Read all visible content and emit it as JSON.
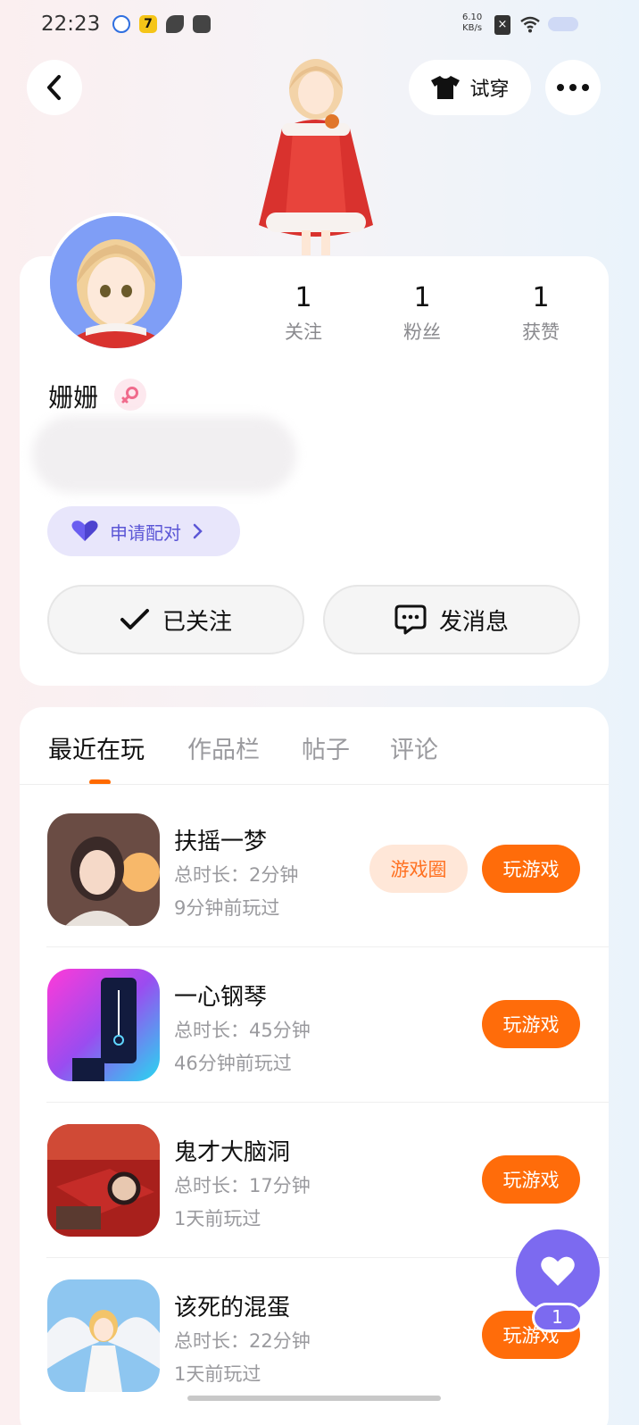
{
  "status_bar": {
    "time": "22:23",
    "speed_value": "6.10",
    "speed_unit": "KB/s",
    "icons": [
      "baidu-icon",
      "seven-app-icon",
      "leaf-app-icon",
      "bag-app-icon",
      "no-sim-icon",
      "wifi-icon",
      "battery-icon"
    ]
  },
  "top_bar": {
    "try_on_label": "试穿"
  },
  "profile": {
    "name": "姗姗",
    "gender": "female",
    "stats": [
      {
        "value": "1",
        "label": "关注"
      },
      {
        "value": "1",
        "label": "粉丝"
      },
      {
        "value": "1",
        "label": "获赞"
      }
    ],
    "pair_label": "申请配对",
    "followed_label": "已关注",
    "message_label": "发消息"
  },
  "tabs": [
    {
      "label": "最近在玩",
      "active": true
    },
    {
      "label": "作品栏",
      "active": false
    },
    {
      "label": "帖子",
      "active": false
    },
    {
      "label": "评论",
      "active": false
    }
  ],
  "games": [
    {
      "title": "扶摇一梦",
      "duration": "总时长：2分钟",
      "last_played": "9分钟前玩过",
      "circle_label": "游戏圈",
      "play_label": "玩游戏"
    },
    {
      "title": "一心钢琴",
      "duration": "总时长：45分钟",
      "last_played": "46分钟前玩过",
      "play_label": "玩游戏"
    },
    {
      "title": "鬼才大脑洞",
      "duration": "总时长：17分钟",
      "last_played": "1天前玩过",
      "play_label": "玩游戏"
    },
    {
      "title": "该死的混蛋",
      "duration": "总时长：22分钟",
      "last_played": "1天前玩过",
      "play_label": "玩游戏"
    }
  ],
  "floating_like": {
    "count": "1"
  },
  "colors": {
    "accent": "#ff6c0a",
    "pair_purple": "#5b56d6",
    "fab_purple": "#7c6af0"
  }
}
